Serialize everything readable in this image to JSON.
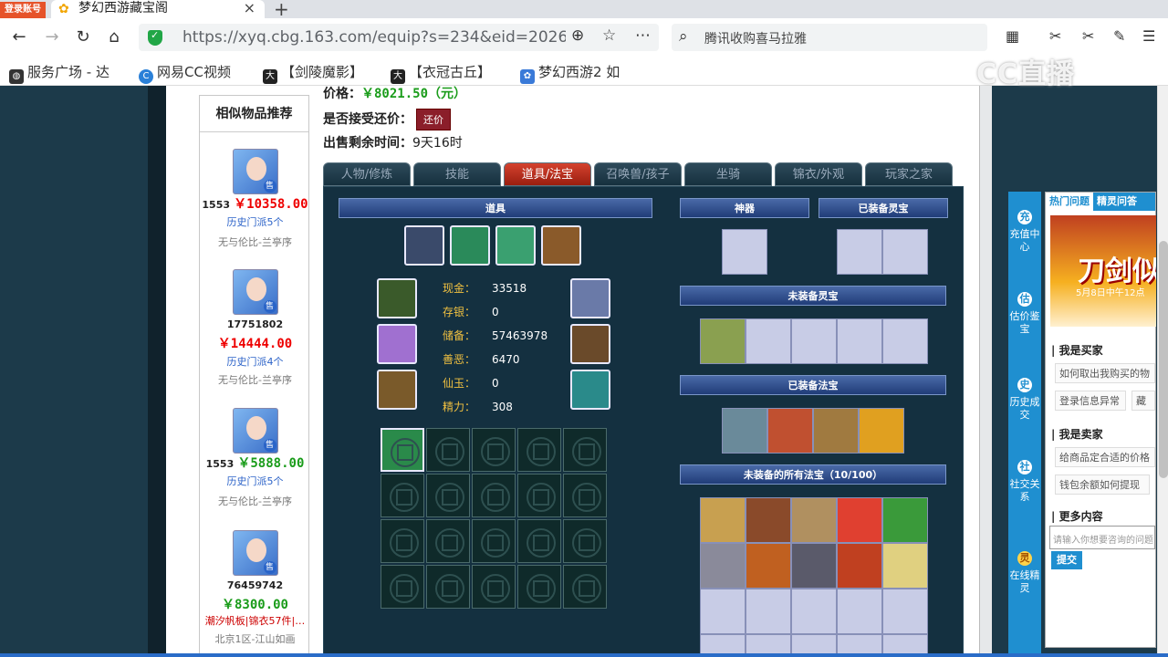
{
  "browser": {
    "login_badge": "登录账号",
    "tab_title": "梦幻西游藏宝阁",
    "url": "https://xyq.cbg.163.com/equip?s=234&eid=2026(",
    "search_query": "腾讯收购喜马拉雅",
    "bookmarks": [
      "服务广场 - 达",
      "网易CC视频",
      "【剑陵魔影】",
      "【衣冠古丘】",
      "梦幻西游2 如"
    ],
    "watermark": "CC直播"
  },
  "sidebar": {
    "title": "相似物品推荐",
    "items": [
      {
        "level": "1553",
        "price": "￥10358.00",
        "history": "历史门派5个",
        "server": "无与伦比-兰亭序",
        "green": false
      },
      {
        "level": "17751802",
        "price": "￥14444.00",
        "history": "历史门派4个",
        "server": "无与伦比-兰亭序",
        "green": false
      },
      {
        "level": "1553",
        "price": "￥5888.00",
        "history": "历史门派5个",
        "server": "无与伦比-兰亭序",
        "green": true
      },
      {
        "level": "76459742",
        "price": "￥8300.00",
        "history": "潮汐帆板|锦衣57件|…",
        "server": "北京1区-江山如画",
        "green": true
      }
    ]
  },
  "listing": {
    "price_label": "价格：",
    "price_value": "￥8021.50（元）",
    "bargain_label": "是否接受还价：",
    "bargain_button": "还价",
    "time_label": "出售剩余时间：",
    "time_value": "9天16时"
  },
  "tabs": [
    "人物/修炼",
    "技能",
    "道具/法宝",
    "召唤兽/孩子",
    "坐骑",
    "锦衣/外观",
    "玩家之家"
  ],
  "active_tab": 2,
  "game": {
    "items_header": "道具",
    "shenqi_header": "神器",
    "equipped_lingbao_header": "已装备灵宝",
    "unequipped_lingbao_header": "未装备灵宝",
    "equipped_fabao_header": "已装备法宝",
    "unequipped_fabao_header": "未装备的所有法宝（10/100）",
    "stats": [
      {
        "label": "现金：",
        "value": "33518"
      },
      {
        "label": "存银：",
        "value": "0"
      },
      {
        "label": "储备：",
        "value": "57463978"
      },
      {
        "label": "善恶：",
        "value": "6470"
      },
      {
        "label": "仙玉：",
        "value": "0"
      },
      {
        "label": "精力：",
        "value": "308"
      }
    ],
    "colors": {
      "panel_bg": "#143040",
      "bar": "#203c78",
      "slot": "#c8cce6"
    }
  },
  "help": {
    "tab_hot": "热门问题",
    "tab_elf": "精灵问答",
    "banner_title": "刀剑似",
    "banner_date": "5月8日中午12点",
    "buyer_header": "我是买家",
    "buyer_q1": "如何取出我购买的物",
    "buyer_q2": "登录信息异常",
    "buyer_q3": "藏",
    "seller_header": "我是卖家",
    "seller_q1": "给商品定合适的价格",
    "seller_q2": "钱包余额如何提现",
    "more_header": "更多内容",
    "input_placeholder": "请输入你想要咨询的问题",
    "submit": "提交"
  },
  "dock": [
    {
      "icon": "充",
      "label": "充值中心"
    },
    {
      "icon": "估",
      "label": "估价鉴宝"
    },
    {
      "icon": "史",
      "label": "历史成交"
    },
    {
      "icon": "社",
      "label": "社交关系"
    },
    {
      "icon": "灵",
      "label": "在线精灵"
    }
  ]
}
